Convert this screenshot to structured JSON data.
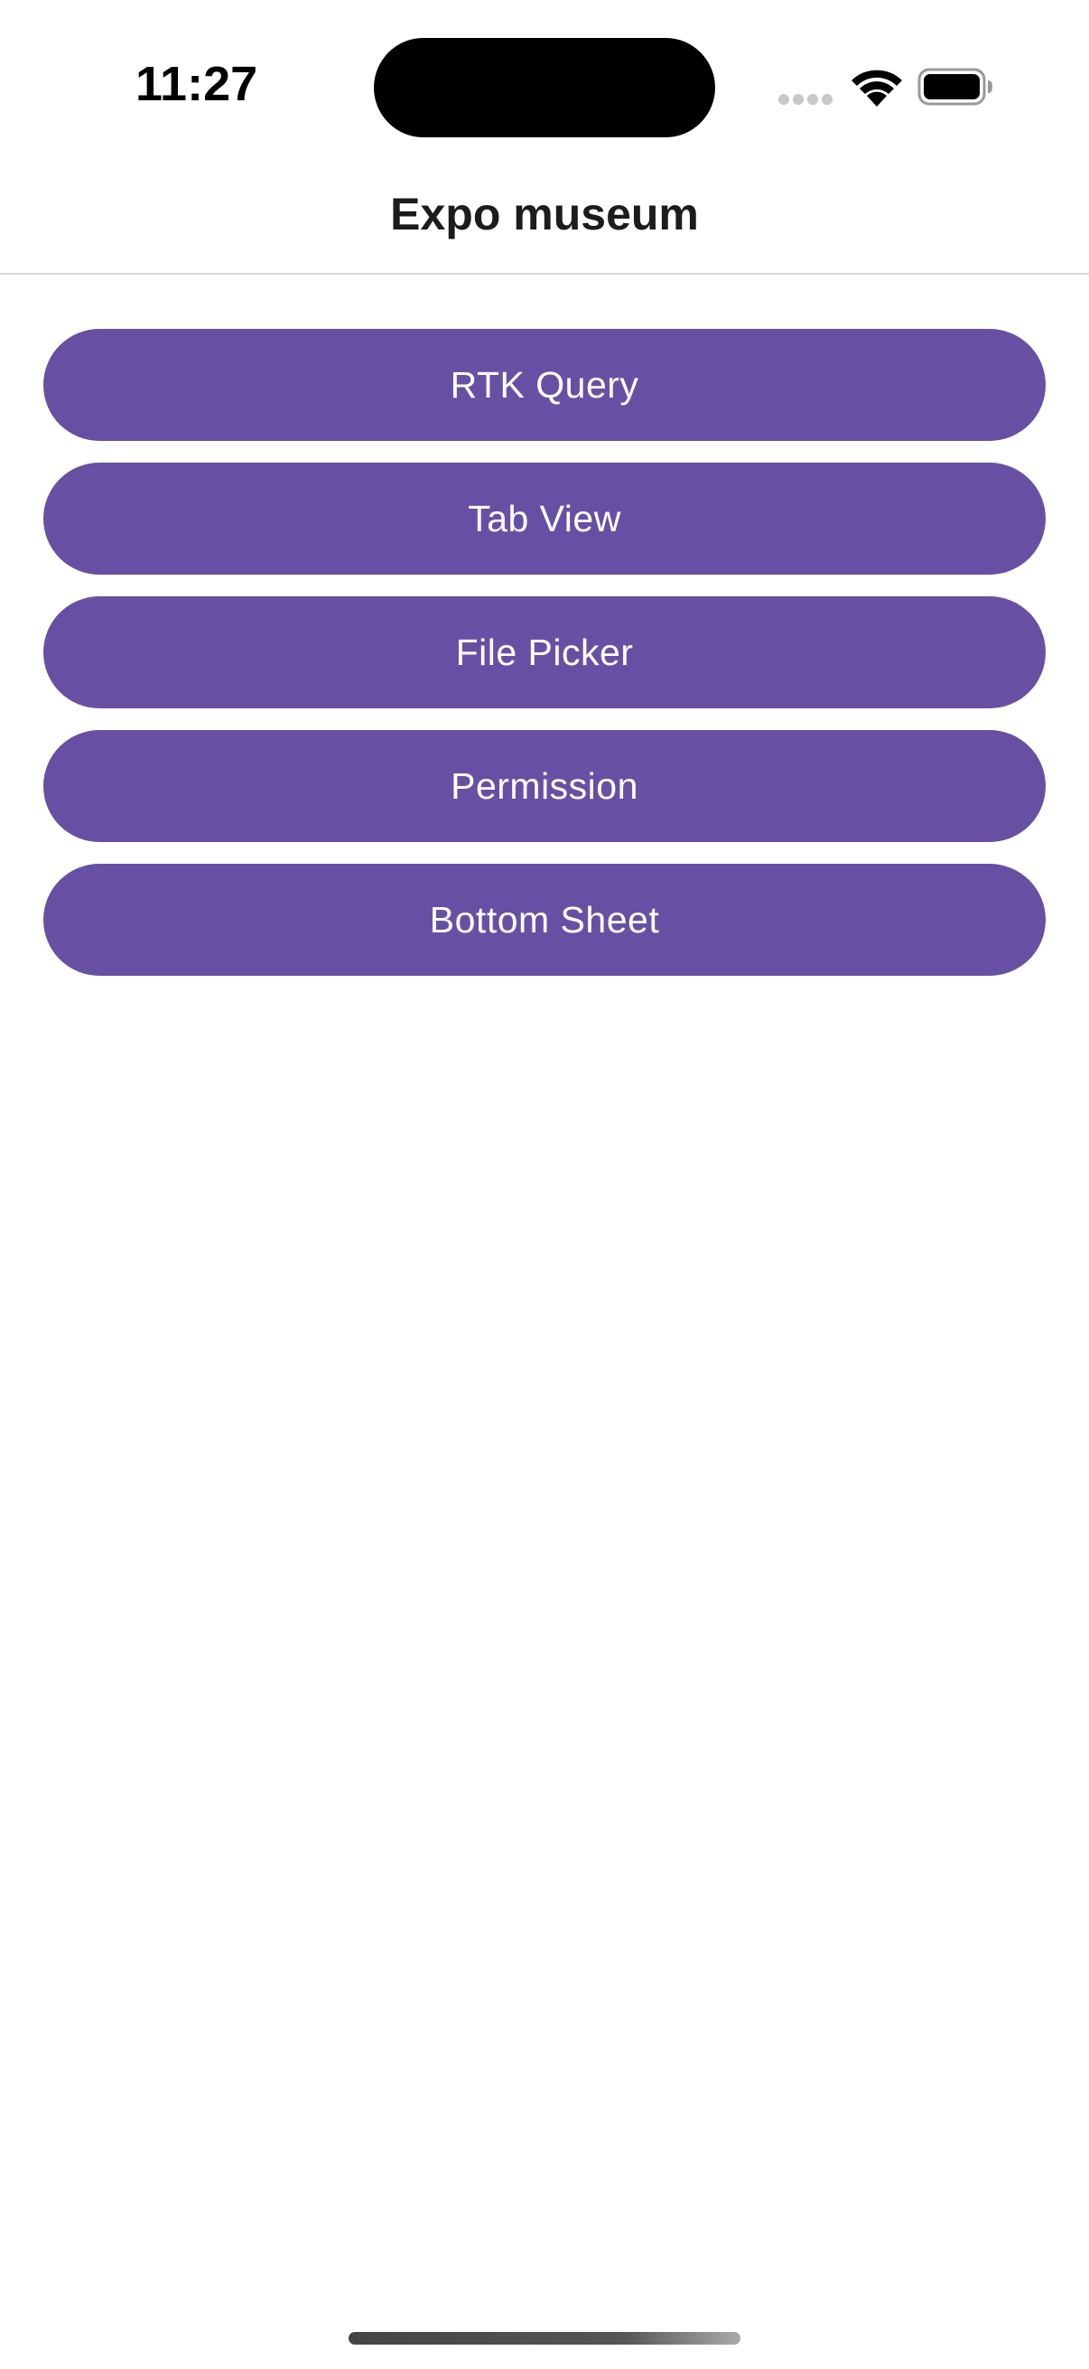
{
  "status_bar": {
    "time": "11:27",
    "icons": [
      "cellular-signal-icon",
      "wifi-icon",
      "battery-icon"
    ]
  },
  "header": {
    "title": "Expo museum"
  },
  "menu": {
    "items": [
      {
        "label": "RTK Query"
      },
      {
        "label": "Tab View"
      },
      {
        "label": "File Picker"
      },
      {
        "label": "Permission"
      },
      {
        "label": "Bottom Sheet"
      }
    ]
  },
  "colors": {
    "button_background": "#6750a4",
    "button_text": "#ffffff",
    "header_divider": "#d8d8d8"
  }
}
